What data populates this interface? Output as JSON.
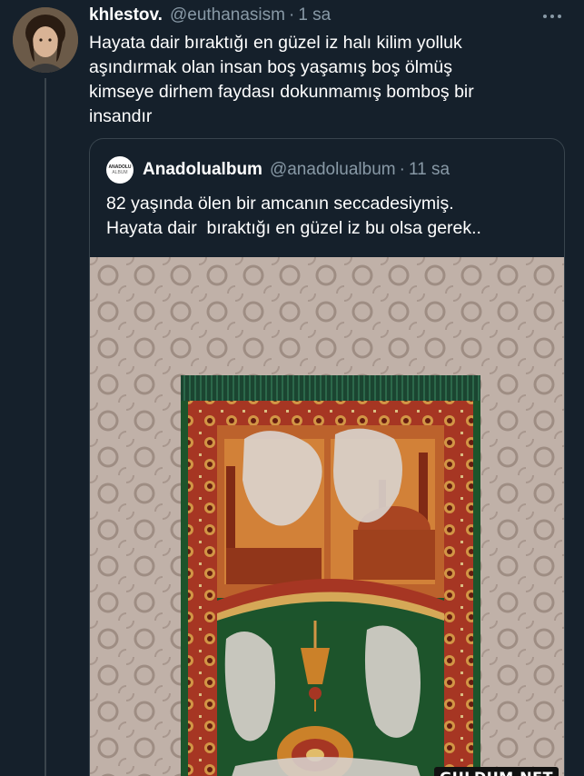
{
  "tweet": {
    "display_name": "khlestov.",
    "handle": "@euthanasism",
    "separator": "·",
    "time": "1 sa",
    "more_icon": "more-horizontal-icon",
    "lines": [
      "Hayata dair bıraktığı en güzel iz halı kilim yolluk",
      "aşındırmak olan insan boş yaşamış boş ölmüş",
      "kimseye dirhem faydası dokunmamış bomboş bir",
      "insandır"
    ]
  },
  "quote": {
    "avatar_lines": [
      "ANADOLU",
      "ALBUM"
    ],
    "display_name": "Anadolualbum",
    "handle": "@anadolualbum",
    "separator": "·",
    "time": "11 sa",
    "lines": [
      "82 yaşında ölen bir amcanın seccadesiymiş.",
      "Hayata dair  bıraktığı en güzel iz bu olsa gerek.."
    ]
  },
  "watermark": "GULDUM.NET",
  "colors": {
    "background": "#15202b",
    "secondary_text": "#8899a6",
    "border": "#38444d",
    "rug_green": "#1f5a2e",
    "rug_red": "#b8342a",
    "rug_gold": "#d79a3a"
  }
}
